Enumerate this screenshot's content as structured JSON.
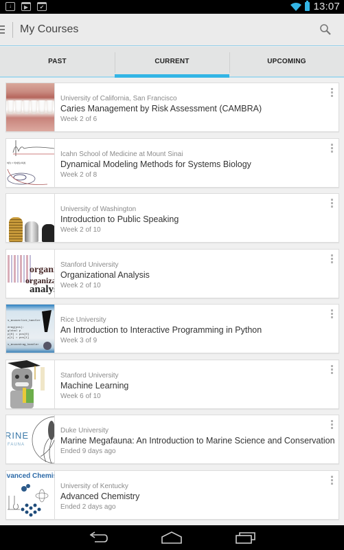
{
  "status_bar": {
    "notification_icons": [
      "download-icon",
      "play-store-icon",
      "task-done-icon"
    ],
    "wifi_icon": "wifi-icon",
    "battery_icon": "battery-icon",
    "time": "13:07"
  },
  "action_bar": {
    "drawer_icon": "hamburger-menu-icon",
    "title": "My Courses",
    "search_icon": "search-icon"
  },
  "tabs": [
    {
      "label": "PAST",
      "active": false
    },
    {
      "label": "CURRENT",
      "active": true
    },
    {
      "label": "UPCOMING",
      "active": false
    }
  ],
  "accent_color": "#33b5e5",
  "courses": [
    {
      "university": "University of California, San Francisco",
      "title": "Caries Management by Risk Assessment (CAMBRA)",
      "progress": "Week 2 of 6",
      "thumbnail": "teeth-smile"
    },
    {
      "university": "Icahn School of Medicine at Mount Sinai",
      "title": "Dynamical Modeling Methods for Systems Biology",
      "progress": "Week 2 of 8",
      "thumbnail": "equations-plot"
    },
    {
      "university": "University of Washington",
      "title": "Introduction to Public Speaking",
      "progress": "Week 2 of 10",
      "thumbnail": "microphones"
    },
    {
      "university": "Stanford University",
      "title": "Organizational Analysis",
      "progress": "Week 2 of 10",
      "thumbnail": "word-cloud"
    },
    {
      "university": "Rice University",
      "title": "An Introduction to Interactive Programming in Python",
      "progress": "Week 3 of 9",
      "thumbnail": "python-code"
    },
    {
      "university": "Stanford University",
      "title": "Machine Learning",
      "progress": "Week 6 of 10",
      "thumbnail": "graduate-robot"
    },
    {
      "university": "Duke University",
      "title": "Marine Megafauna: An Introduction to Marine Science and Conservation",
      "progress": "Ended 9 days ago",
      "thumbnail": "squid-logo",
      "thumb_text": [
        "RINE",
        "FAUNA"
      ]
    },
    {
      "university": "University of Kentucky",
      "title": "Advanced Chemistry",
      "progress": "Ended 2 days ago",
      "thumbnail": "chemistry-molecules",
      "thumb_text": [
        "lvanced Chemis"
      ]
    }
  ],
  "nav_bar": {
    "back": "back-icon",
    "home": "home-icon",
    "recents": "recent-apps-icon"
  }
}
